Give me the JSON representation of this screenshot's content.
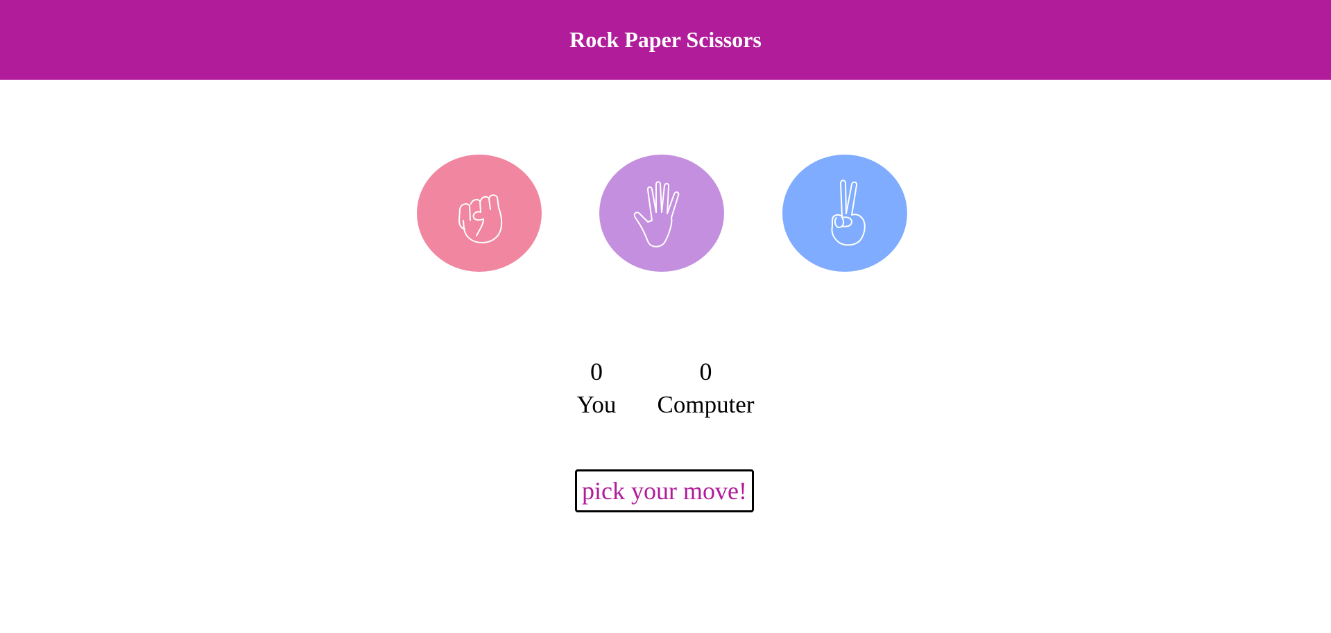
{
  "colors": {
    "header_bg": "#b01c9a",
    "rock": "#f0869f",
    "paper": "#c38fde",
    "scissors": "#80acff",
    "message_text": "#b01c9a"
  },
  "header": {
    "title": "Rock Paper Scissors"
  },
  "choices": [
    {
      "id": "rock",
      "icon": "fist-icon"
    },
    {
      "id": "paper",
      "icon": "open-hand-icon"
    },
    {
      "id": "scissors",
      "icon": "peace-hand-icon"
    }
  ],
  "scoreboard": {
    "you": {
      "score": "0",
      "label": "You"
    },
    "computer": {
      "score": "0",
      "label": "Computer"
    }
  },
  "message": {
    "text": "pick your move!"
  }
}
